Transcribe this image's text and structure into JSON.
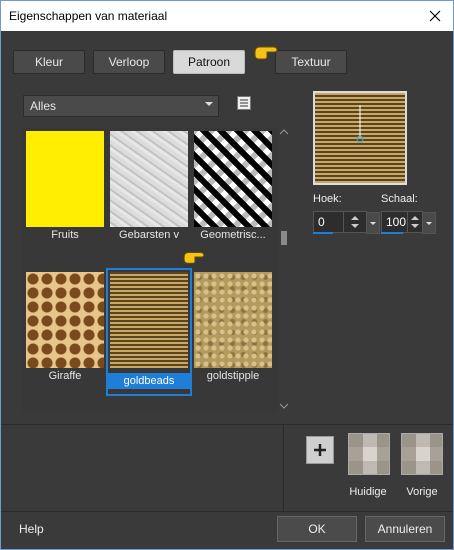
{
  "window": {
    "title": "Eigenschappen van materiaal"
  },
  "tabs": [
    {
      "label": "Kleur",
      "active": false
    },
    {
      "label": "Verloop",
      "active": false
    },
    {
      "label": "Patroon",
      "active": true
    },
    {
      "label": "Textuur",
      "active": false
    }
  ],
  "category": {
    "value": "Alles"
  },
  "patterns": [
    {
      "label": "Fruits",
      "selected": false
    },
    {
      "label": "Gebarsten v",
      "selected": false
    },
    {
      "label": "Geometrisc...",
      "selected": false
    },
    {
      "label": "Giraffe",
      "selected": false
    },
    {
      "label": "goldbeads",
      "selected": true
    },
    {
      "label": "goldstipple",
      "selected": false
    }
  ],
  "angle": {
    "label": "Hoek:",
    "value": "0"
  },
  "scale": {
    "label": "Schaal:",
    "value": "100"
  },
  "history": {
    "current_label": "Huidige",
    "previous_label": "Vorige"
  },
  "footer": {
    "help": "Help",
    "ok": "OK",
    "cancel": "Annuleren"
  },
  "colors": {
    "accent": "#1e7ed8",
    "pointer_yellow": "#f3c318"
  },
  "icons": {
    "close": "close-icon",
    "menu": "list-menu-icon",
    "hand": "pointing-hand-icon",
    "plus": "plus-icon",
    "dropdown": "chevron-down-icon"
  }
}
